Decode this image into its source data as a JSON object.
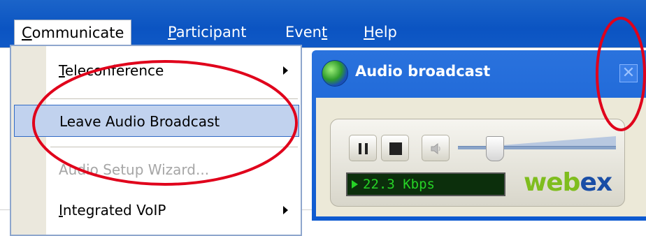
{
  "menubar": {
    "items": [
      {
        "label": "Communicate",
        "ul": "C",
        "rest": "ommunicate",
        "active": true
      },
      {
        "label": "Participant",
        "ul": "P",
        "rest": "articipant"
      },
      {
        "label": "Event",
        "pre": "Even",
        "ul": "t"
      },
      {
        "label": "Help",
        "ul": "H",
        "rest": "elp"
      }
    ]
  },
  "dropdown": {
    "items": [
      {
        "label": "Teleconference",
        "ul": "T",
        "rest": "eleconference",
        "submenu": true
      },
      {
        "label": "Leave Audio Broadcast",
        "highlighted": true
      },
      {
        "label": "Audio Setup Wizard...",
        "disabled": true
      },
      {
        "label": "Integrated VoIP",
        "ul": "I",
        "rest": "ntegrated VoIP",
        "submenu": true
      }
    ]
  },
  "audio_window": {
    "title": "Audio broadcast",
    "rate": "22.3 Kbps",
    "logo_a": "web",
    "logo_b": "ex",
    "volume_level": 0.3
  },
  "colors": {
    "menubar_blue": "#0b54c2",
    "highlight": "#c1d2ee",
    "annotation_red": "#e0001b",
    "meter_green": "#26d326"
  }
}
